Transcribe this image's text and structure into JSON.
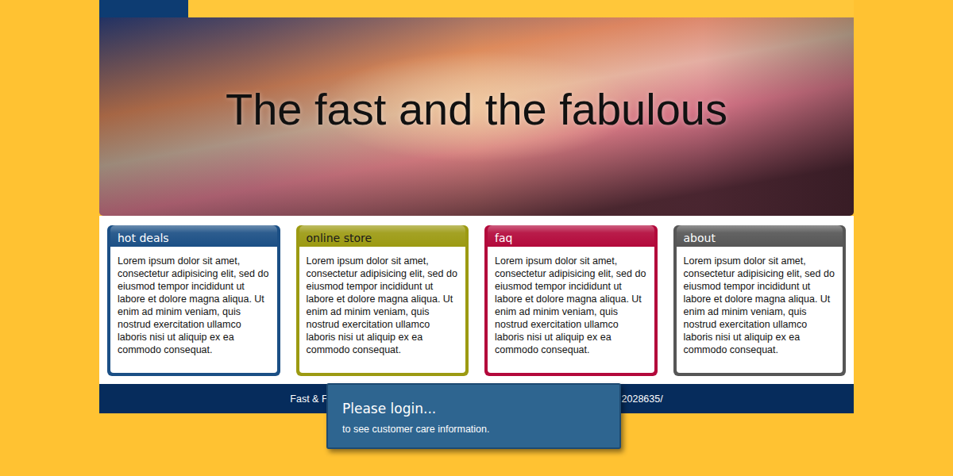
{
  "banner": {
    "title": "The fast and the fabulous"
  },
  "cards": [
    {
      "title": "hot deals",
      "body": "Lorem ipsum dolor sit amet, consectetur adipisicing elit, sed do eiusmod tempor incididunt ut labore et dolore magna aliqua. Ut enim ad minim veniam, quis nostrud exercitation ullamco laboris nisi ut aliquip ex ea commodo consequat.",
      "color": "#1b4f85",
      "text_color": "#ffffff"
    },
    {
      "title": "online store",
      "body": "Lorem ipsum dolor sit amet, consectetur adipisicing elit, sed do eiusmod tempor incididunt ut labore et dolore magna aliqua. Ut enim ad minim veniam, quis nostrud exercitation ullamco laboris nisi ut aliquip ex ea commodo consequat.",
      "color": "#9c9a12",
      "text_color": "#1a1a1a"
    },
    {
      "title": "faq",
      "body": "Lorem ipsum dolor sit amet, consectetur adipisicing elit, sed do eiusmod tempor incididunt ut labore et dolore magna aliqua. Ut enim ad minim veniam, quis nostrud exercitation ullamco laboris nisi ut aliquip ex ea commodo consequat.",
      "color": "#b3093b",
      "text_color": "#ffffff"
    },
    {
      "title": "about",
      "body": "Lorem ipsum dolor sit amet, consectetur adipisicing elit, sed do eiusmod tempor incididunt ut labore et dolore magna aliqua. Ut enim ad minim veniam, quis nostrud exercitation ullamco laboris nisi ut aliquip ex ea commodo consequat.",
      "color": "#565656",
      "text_color": "#ffffff"
    }
  ],
  "footer": {
    "left": "Fast & F",
    "right": "2028635/"
  },
  "popup": {
    "title": "Please login...",
    "message": "to see customer care information."
  }
}
